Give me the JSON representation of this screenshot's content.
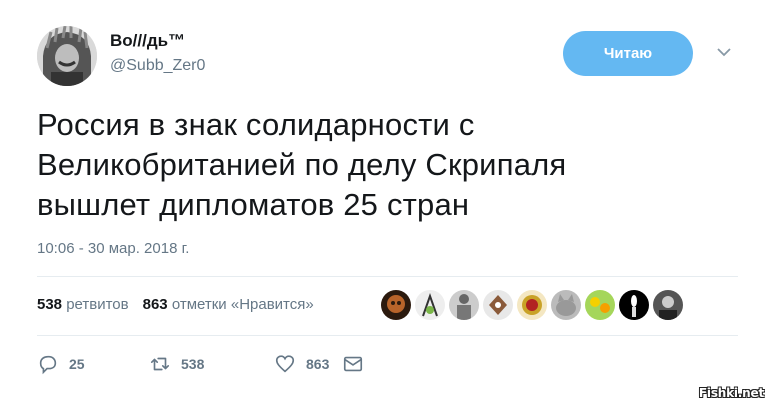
{
  "author": {
    "name": "Во///дь™",
    "handle": "@Subb_Zer0"
  },
  "follow_button": {
    "label": "Читаю",
    "color": "#64b8f2"
  },
  "tweet": {
    "line1": "Россия в знак солидарности с",
    "line2": "Великобританией по делу Скрипаля",
    "line3": "вышлет дипломатов 25 стран",
    "timestamp": "10:06 - 30 мар. 2018 г."
  },
  "stats": {
    "retweets_count": "538",
    "retweets_label": "ретвитов",
    "likes_count": "863",
    "likes_label": "отметки «Нравится»"
  },
  "actions": {
    "reply_count": "25",
    "retweet_count": "538",
    "like_count": "863"
  },
  "likers_icons": [
    "skull-avatar",
    "figure-avatar",
    "statue-avatar",
    "emblem-avatar",
    "ussr-emblem-avatar",
    "cat-avatar",
    "flowers-avatar",
    "candle-avatar",
    "portrait-avatar"
  ],
  "watermark": "Fishki.net",
  "colors": {
    "secondary": "#657786",
    "text": "#14171a",
    "accent": "#1da1f2"
  }
}
